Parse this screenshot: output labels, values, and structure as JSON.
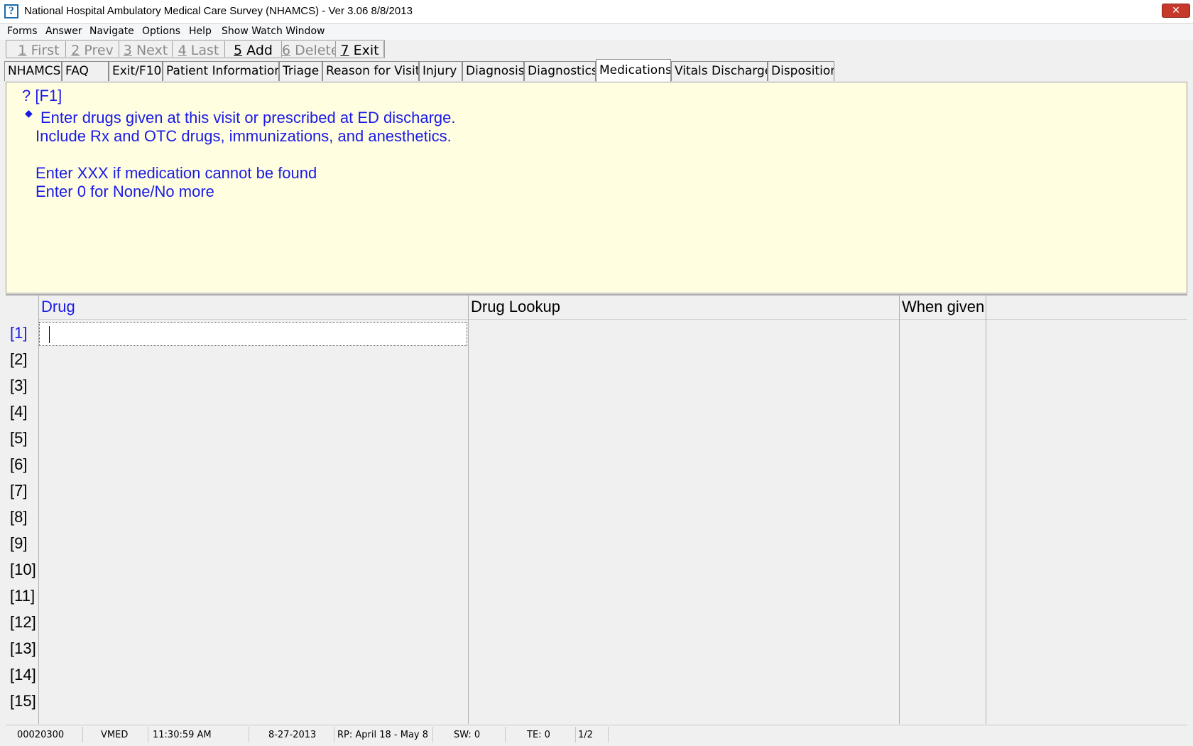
{
  "window": {
    "title": "National Hospital Ambulatory Medical Care Survey (NHAMCS) - Ver 3.06 8/8/2013",
    "close_label": "✕"
  },
  "menu": [
    "Forms",
    "Answer",
    "Navigate",
    "Options",
    "Help",
    "Show Watch Window"
  ],
  "toolbar": [
    {
      "key": "1",
      "label": "First",
      "enabled": false
    },
    {
      "key": "2",
      "label": "Prev",
      "enabled": false
    },
    {
      "key": "3",
      "label": "Next",
      "enabled": false
    },
    {
      "key": "4",
      "label": "Last",
      "enabled": false
    },
    {
      "key": "5",
      "label": "Add",
      "enabled": true
    },
    {
      "key": "6",
      "label": "Delete",
      "enabled": false
    },
    {
      "key": "7",
      "label": "Exit",
      "enabled": true
    }
  ],
  "tabs": [
    "NHAMCS",
    "FAQ",
    "Exit/F10",
    "Patient Information",
    "Triage",
    "Reason for Visit",
    "Injury",
    "Diagnosis",
    "Diagnostics",
    "Medications",
    "Vitals Discharge",
    "Disposition"
  ],
  "active_tab": "Medications",
  "info": {
    "help_key": "? [F1]",
    "line1": "Enter drugs given at this visit or prescribed at ED discharge.",
    "line2": "Include Rx and OTC drugs, immunizations, and anesthetics.",
    "line3": "Enter XXX if medication cannot be found",
    "line4": "Enter 0 for None/No more"
  },
  "grid": {
    "columns": [
      "Drug",
      "Drug Lookup",
      "When given"
    ],
    "rows": [
      "[1]",
      "[2]",
      "[3]",
      "[4]",
      "[5]",
      "[6]",
      "[7]",
      "[8]",
      "[9]",
      "[10]",
      "[11]",
      "[12]",
      "[13]",
      "[14]",
      "[15]"
    ],
    "drug_value": ""
  },
  "status": {
    "case_id": "00020300",
    "field": "VMED",
    "time": "11:30:59 AM",
    "date": "8-27-2013",
    "rp": "RP: April 18  -  May 8",
    "sw": "SW: 0",
    "te": "TE: 0",
    "page": "1/2"
  },
  "colors": {
    "prompt_text": "#1a1ae6",
    "info_background": "#fffee0",
    "close_button": "#c7392b"
  }
}
